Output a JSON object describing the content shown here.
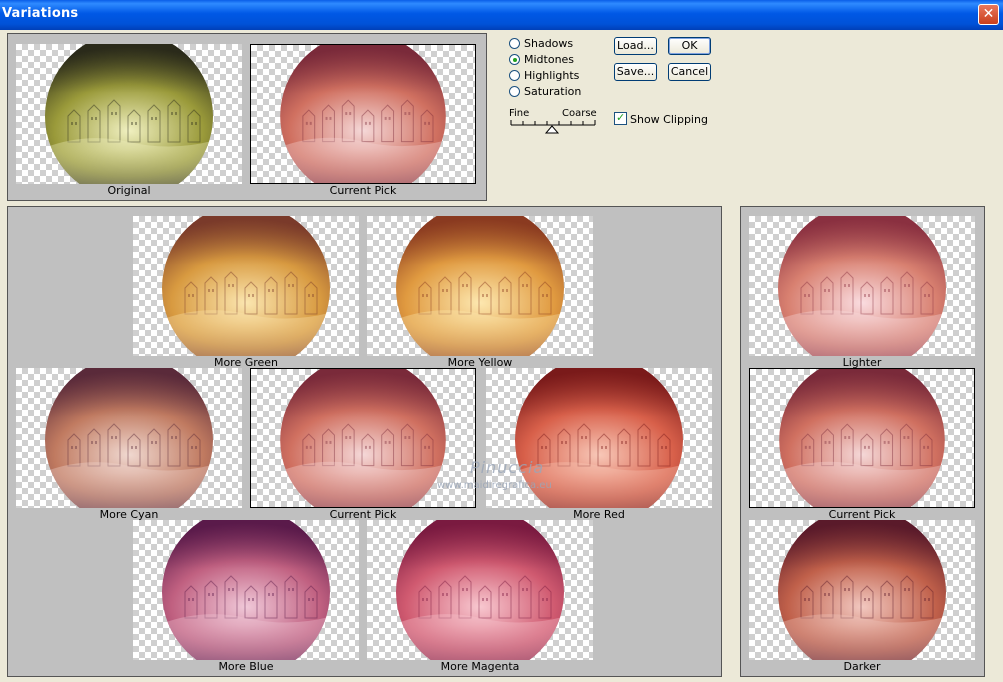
{
  "window": {
    "title": "Variations",
    "close_icon": "close-icon"
  },
  "controls": {
    "radios": [
      {
        "label": "Shadows",
        "checked": false
      },
      {
        "label": "Midtones",
        "checked": true
      },
      {
        "label": "Highlights",
        "checked": false
      },
      {
        "label": "Saturation",
        "checked": false
      }
    ],
    "load_label": "Load...",
    "ok_label": "OK",
    "save_label": "Save...",
    "cancel_label": "Cancel",
    "fine_label": "Fine",
    "coarse_label": "Coarse",
    "show_clipping_label": "Show Clipping",
    "show_clipping_checked": true
  },
  "top_preview": {
    "original_label": "Original",
    "current_pick_label": "Current Pick"
  },
  "color_grid": {
    "more_green": "More Green",
    "more_yellow": "More Yellow",
    "more_cyan": "More Cyan",
    "current_pick": "Current Pick",
    "more_red": "More Red",
    "more_blue": "More Blue",
    "more_magenta": "More Magenta"
  },
  "brightness": {
    "lighter": "Lighter",
    "current_pick": "Current Pick",
    "darker": "Darker"
  },
  "watermark": {
    "line1": "Pinuccia",
    "line2": "www.maidiregrafica.eu"
  },
  "colors": {
    "original": [
      "#f0f0c0",
      "#9a9a3a",
      "#2a2a1a"
    ],
    "current": [
      "#f5d8d8",
      "#d07060",
      "#7a2a3a"
    ],
    "green": [
      "#fbe6b0",
      "#d89a40",
      "#7a3a2a"
    ],
    "yellow": [
      "#fde8b0",
      "#e09a40",
      "#8a3a20"
    ],
    "cyan": [
      "#f0d8d0",
      "#c07a60",
      "#5a2a3a"
    ],
    "red": [
      "#f8c8b8",
      "#d8604a",
      "#7a1a1a"
    ],
    "blue": [
      "#f0c8d8",
      "#c06080",
      "#5a1a4a"
    ],
    "magenta": [
      "#f8c8d0",
      "#d05a70",
      "#7a1a40"
    ],
    "lighter": [
      "#fadce0",
      "#d88070",
      "#8a3040"
    ],
    "darker": [
      "#f2c8c0",
      "#c0604a",
      "#5a1a2a"
    ]
  }
}
